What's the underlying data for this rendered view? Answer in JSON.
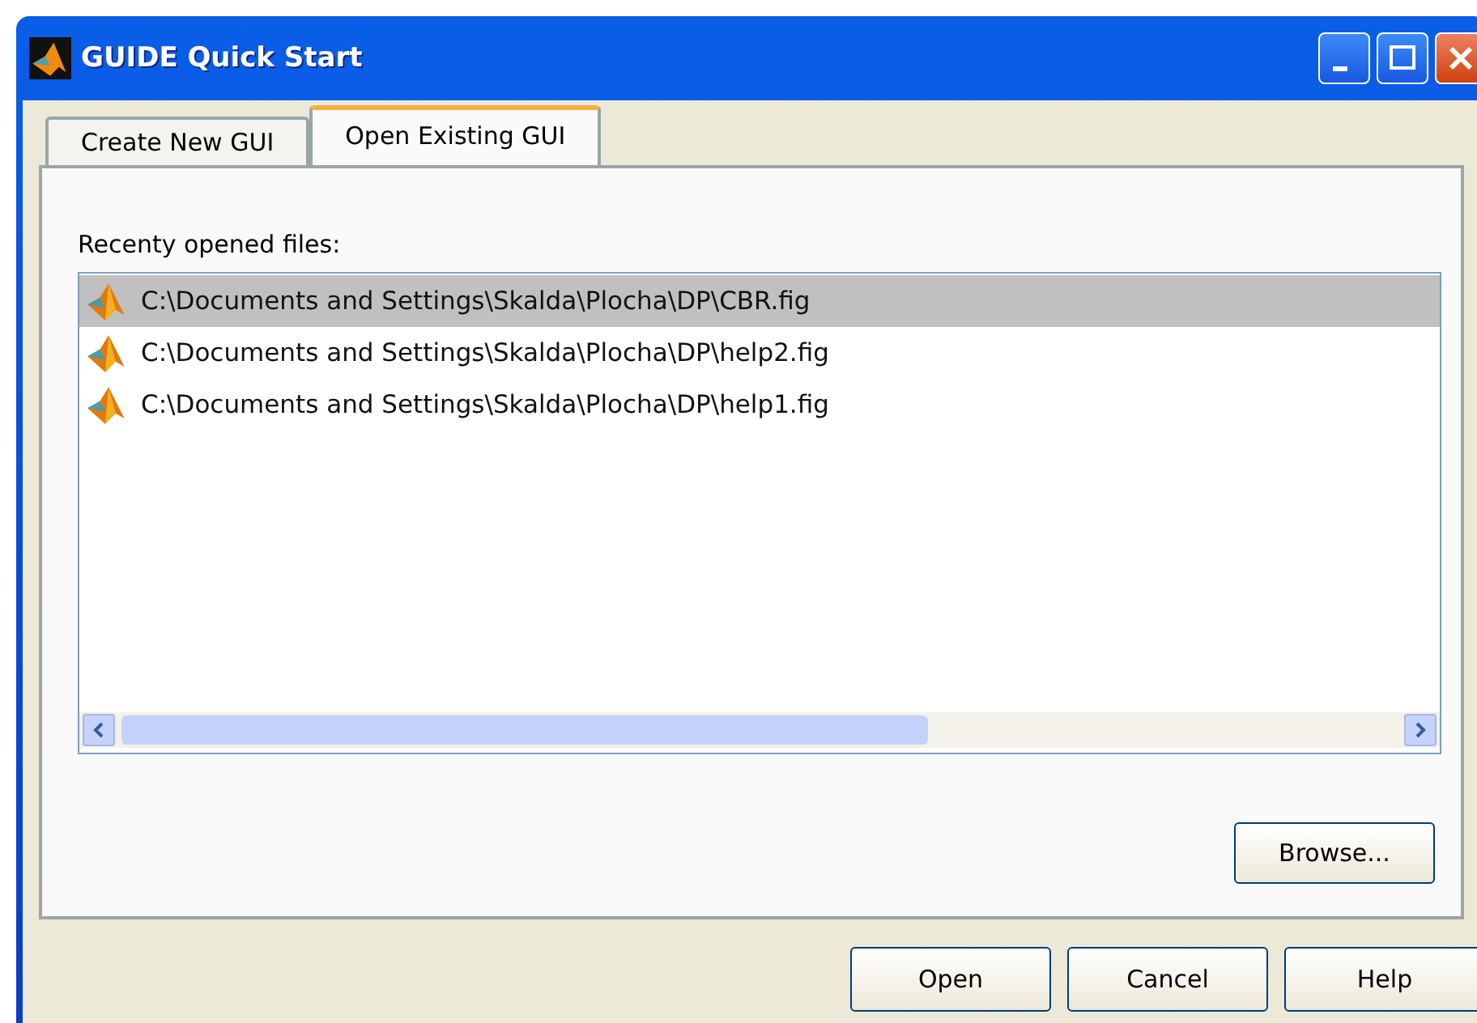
{
  "window": {
    "title": "GUIDE Quick Start"
  },
  "tabs": [
    {
      "label": "Create New GUI",
      "selected": false
    },
    {
      "label": "Open Existing GUI",
      "selected": true
    }
  ],
  "recent_files": {
    "label": "Recenty opened files:",
    "items": [
      {
        "path": "C:\\Documents and Settings\\Skalda\\Plocha\\DP\\CBR.fig",
        "selected": true
      },
      {
        "path": "C:\\Documents and Settings\\Skalda\\Plocha\\DP\\help2.fig",
        "selected": false
      },
      {
        "path": "C:\\Documents and Settings\\Skalda\\Plocha\\DP\\help1.fig",
        "selected": false
      }
    ]
  },
  "browse_button": "Browse...",
  "buttons": [
    "Open",
    "Cancel",
    "Help"
  ]
}
